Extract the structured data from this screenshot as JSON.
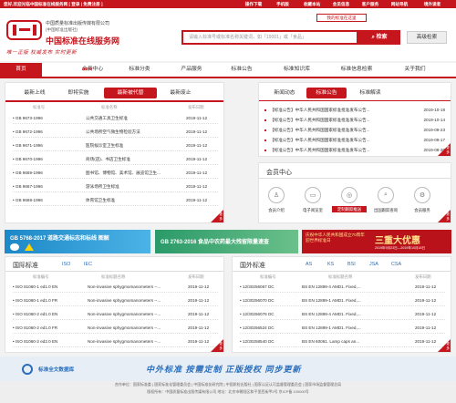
{
  "topbar": {
    "welcome": "您好,欢迎光临中国标准在线服务网 [ 登录 | 免费注册 ]",
    "links": [
      "操作下载",
      "手机版",
      "收藏本站",
      "会员信息",
      "客户服务",
      "网站导航",
      "境外读者"
    ]
  },
  "header": {
    "org_line1": "中国质量标准出版传媒有限公司",
    "org_line2": "(中国标准出版社)",
    "site_name": "中国标准在线服务网",
    "slogan": "唯一正版 权威发布 实时更新",
    "my_standards": "我的标准在这里",
    "search_placeholder": "请输入标准号或标准名称关键词，如「19001」或「食品」",
    "search_button": "检索",
    "advanced_button": "高级检索"
  },
  "nav": {
    "items": [
      "首页",
      "会员中心",
      "标准分类",
      "产品服务",
      "标准公告",
      "标准知识库",
      "标准信息检索",
      "关于我们"
    ],
    "new_tag": "new"
  },
  "standards_panel": {
    "tabs": [
      "最新上线",
      "即将实施",
      "最新被代替",
      "最新废止"
    ],
    "col_number": "标准号",
    "col_name": "标准名称",
    "col_date": "发布日期",
    "rows": [
      {
        "num": "GB 9673-1996",
        "name": "公共交通工具卫生标准",
        "date": "2019-11-12"
      },
      {
        "num": "GB 9672-1996",
        "name": "公共场所空气微生物检验方法",
        "date": "2019-11-12"
      },
      {
        "num": "GB 9671-1996",
        "name": "医院候诊室卫生标准",
        "date": "2019-11-12"
      },
      {
        "num": "GB 9670-1996",
        "name": "商场(店)、书店卫生标准",
        "date": "2019-11-12"
      },
      {
        "num": "GB 9669-1996",
        "name": "图书馆、博物馆、美术馆、展览馆卫生...",
        "date": "2019-11-12"
      },
      {
        "num": "GB 9667-1996",
        "name": "游泳场所卫生标准",
        "date": "2019-11-12"
      },
      {
        "num": "GB 9668-1996",
        "name": "体育馆卫生标准",
        "date": "2019-11-12"
      }
    ],
    "more": "更多"
  },
  "news_panel": {
    "tabs": [
      "新闻动态",
      "标准公告",
      "标准解读"
    ],
    "items": [
      {
        "text": "【标准公告】中华人民共和国国家标准批准发布公告...",
        "date": "2019-10-18"
      },
      {
        "text": "【标准公告】中华人民共和国国家标准批准发布公告...",
        "date": "2019-10-14"
      },
      {
        "text": "【标准公告】中华人民共和国国家标准批准发布公告...",
        "date": "2019-09-23"
      },
      {
        "text": "【标准公告】中华人民共和国国家标准批准发布公告...",
        "date": "2019-09-17"
      },
      {
        "text": "【标准公告】中华人民共和国国家标准批准发布公告...",
        "date": "2019-08-30"
      }
    ],
    "more": "更多"
  },
  "member_center": {
    "title": "会员中心",
    "items": [
      "会员介绍",
      "电子阅览室",
      "定制跟踪推送",
      "出国跟踪查询",
      "会员服务"
    ],
    "more": "更多"
  },
  "banners": [
    {
      "text": "GB 5768-2017 道路交通标志和标线 图解"
    },
    {
      "text": "GB 2763-2016 食品中农药最大残留限量速查"
    },
    {
      "text": "庆祝中华人民共和国成立70周年 迎世界标准日",
      "big": "三重大优惠",
      "sub": "2019年9月23日—2019年10月18日"
    }
  ],
  "intl_panel": {
    "title": "国际标准",
    "orgs": [
      "ISO",
      "IEC"
    ],
    "col_number": "标准编号",
    "col_name": "标准标题名称",
    "col_date": "发布日期",
    "rows": [
      {
        "num": "ISO 81060-1 ed1.0 EN",
        "name": "Non-invasive sphygmomanometers --...",
        "date": "2019-11-12"
      },
      {
        "num": "ISO 81060-1 ed1.0 FR",
        "name": "Non-invasive sphygmomanometers --...",
        "date": "2019-11-12"
      },
      {
        "num": "ISO 81060-2 ed1.0 EN",
        "name": "Non-invasive sphygmomanometers --...",
        "date": "2019-11-12"
      },
      {
        "num": "ISO 81060-2 ed1.0 FR",
        "name": "Non-invasive sphygmomanometers --...",
        "date": "2019-11-12"
      },
      {
        "num": "ISO 81060-2 ed2.0 EN",
        "name": "Non-invasive sphygmomanometers --...",
        "date": "2019-11-12"
      }
    ],
    "more": "更多"
  },
  "foreign_panel": {
    "title": "国外标准",
    "orgs": [
      "AS",
      "KS",
      "BSI",
      "JSA",
      "CSA"
    ],
    "col_number": "标准编号",
    "col_name": "标准标题名称",
    "col_date": "发布日期",
    "rows": [
      {
        "num": "12/30256067 DC",
        "name": "BS EN 12899-4 AMD1. Fixed,...",
        "date": "2019-11-12"
      },
      {
        "num": "12/30256070 DC",
        "name": "BS EN 12899-1 AMD1. Fixed,...",
        "date": "2019-11-12"
      },
      {
        "num": "12/30256076 DC",
        "name": "BS EN 12899-4 AMD1. Fixed,...",
        "date": "2019-11-12"
      },
      {
        "num": "12/30256524 DC",
        "name": "BS EN 12899-1 AMD1. Fixed,...",
        "date": "2019-11-12"
      },
      {
        "num": "12/30258540 DC",
        "name": "BS EN 60061. Lamp caps an...",
        "date": "2019-11-12"
      }
    ],
    "more": "更多"
  },
  "fulltext": {
    "brand": "标准全文数据库",
    "slogan": "中外标准 按需定制 正版授权 同步更新"
  },
  "footer": {
    "line1": "合作单位：国家标准委 | 国家标准化管理委员会 | 中国标准化研究院 | 中国质检出版社 | 国家认证认可监督管理委员会 | 国家市场监督管理总局",
    "line2": "版权所有：中国质量标准出版传媒有限公司  地址：北京市朝阳区和平里西街甲2号  京ICP备 100000号"
  },
  "colors": {
    "brand": "#c5161d",
    "accent": "#c5161d"
  }
}
